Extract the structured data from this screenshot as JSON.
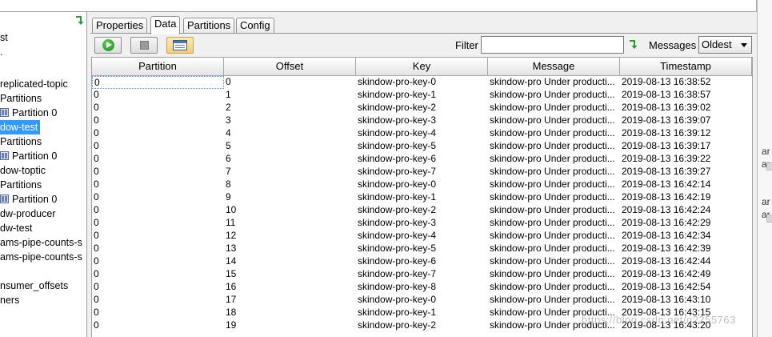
{
  "tree": {
    "nodes": [
      {
        "label": "st",
        "selected": false,
        "icon": null
      },
      {
        "label": ".",
        "selected": false,
        "icon": null
      },
      {
        "label": "replicated-topic",
        "selected": false,
        "icon": null
      },
      {
        "label": "Partitions",
        "selected": false,
        "icon": null
      },
      {
        "label": "Partition 0",
        "selected": false,
        "icon": "partition-grid-icon"
      },
      {
        "label": "dow-test",
        "selected": true,
        "icon": null
      },
      {
        "label": "Partitions",
        "selected": false,
        "icon": null
      },
      {
        "label": "Partition 0",
        "selected": false,
        "icon": "partition-grid-icon"
      },
      {
        "label": "dow-toptic",
        "selected": false,
        "icon": null
      },
      {
        "label": "Partitions",
        "selected": false,
        "icon": null
      },
      {
        "label": "Partition 0",
        "selected": false,
        "icon": "partition-grid-icon"
      },
      {
        "label": "dw-producer",
        "selected": false,
        "icon": null
      },
      {
        "label": "dw-test",
        "selected": false,
        "icon": null
      },
      {
        "label": "ams-pipe-counts-s",
        "selected": false,
        "icon": null
      },
      {
        "label": "ams-pipe-counts-s",
        "selected": false,
        "icon": null
      },
      {
        "label": "",
        "selected": false,
        "icon": null
      },
      {
        "label": "nsumer_offsets",
        "selected": false,
        "icon": null
      },
      {
        "label": "ners",
        "selected": false,
        "icon": null
      }
    ]
  },
  "tabs": [
    {
      "label": "Properties",
      "active": false
    },
    {
      "label": "Data",
      "active": true
    },
    {
      "label": "Partitions",
      "active": false
    },
    {
      "label": "Config",
      "active": false
    }
  ],
  "toolbar": {
    "filter_label": "Filter",
    "filter_value": "",
    "messages_label": "Messages",
    "messages_value": "Oldest"
  },
  "table": {
    "headers": [
      "Partition",
      "Offset",
      "Key",
      "Message",
      "Timestamp"
    ],
    "rows": [
      [
        "0",
        "0",
        "skindow-pro-key-0",
        "skindow-pro Under producti...",
        "2019-08-13 16:38:52"
      ],
      [
        "0",
        "1",
        "skindow-pro-key-1",
        "skindow-pro Under producti...",
        "2019-08-13 16:38:57"
      ],
      [
        "0",
        "2",
        "skindow-pro-key-2",
        "skindow-pro Under producti...",
        "2019-08-13 16:39:02"
      ],
      [
        "0",
        "3",
        "skindow-pro-key-3",
        "skindow-pro Under producti...",
        "2019-08-13 16:39:07"
      ],
      [
        "0",
        "4",
        "skindow-pro-key-4",
        "skindow-pro Under producti...",
        "2019-08-13 16:39:12"
      ],
      [
        "0",
        "5",
        "skindow-pro-key-5",
        "skindow-pro Under producti...",
        "2019-08-13 16:39:17"
      ],
      [
        "0",
        "6",
        "skindow-pro-key-6",
        "skindow-pro Under producti...",
        "2019-08-13 16:39:22"
      ],
      [
        "0",
        "7",
        "skindow-pro-key-7",
        "skindow-pro Under producti...",
        "2019-08-13 16:39:27"
      ],
      [
        "0",
        "8",
        "skindow-pro-key-0",
        "skindow-pro Under producti...",
        "2019-08-13 16:42:14"
      ],
      [
        "0",
        "9",
        "skindow-pro-key-1",
        "skindow-pro Under producti...",
        "2019-08-13 16:42:19"
      ],
      [
        "0",
        "10",
        "skindow-pro-key-2",
        "skindow-pro Under producti...",
        "2019-08-13 16:42:24"
      ],
      [
        "0",
        "11",
        "skindow-pro-key-3",
        "skindow-pro Under producti...",
        "2019-08-13 16:42:29"
      ],
      [
        "0",
        "12",
        "skindow-pro-key-4",
        "skindow-pro Under producti...",
        "2019-08-13 16:42:34"
      ],
      [
        "0",
        "13",
        "skindow-pro-key-5",
        "skindow-pro Under producti...",
        "2019-08-13 16:42:39"
      ],
      [
        "0",
        "14",
        "skindow-pro-key-6",
        "skindow-pro Under producti...",
        "2019-08-13 16:42:44"
      ],
      [
        "0",
        "15",
        "skindow-pro-key-7",
        "skindow-pro Under producti...",
        "2019-08-13 16:42:49"
      ],
      [
        "0",
        "16",
        "skindow-pro-key-8",
        "skindow-pro Under producti...",
        "2019-08-13 16:42:54"
      ],
      [
        "0",
        "17",
        "skindow-pro-key-0",
        "skindow-pro Under producti...",
        "2019-08-13 16:43:10"
      ],
      [
        "0",
        "18",
        "skindow-pro-key-1",
        "skindow-pro Under producti...",
        "2019-08-13 16:43:15"
      ],
      [
        "0",
        "19",
        "skindow-pro-key-2",
        "skindow-pro Under producti...",
        "2019-08-13 16:43:20"
      ]
    ]
  },
  "right_panel": {
    "fragments": [
      "ar",
      "ar",
      "ar",
      "ar"
    ]
  },
  "watermark": "https://blog.csdn.net/q2255763",
  "colors": {
    "selection": "#3399ff",
    "play": "#178a17",
    "pressed_button": "#f6cf73"
  }
}
